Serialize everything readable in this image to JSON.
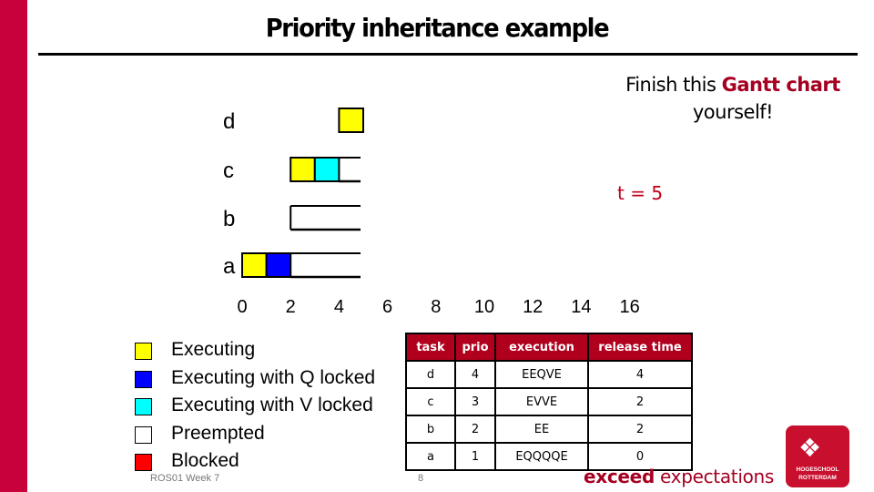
{
  "slide": {
    "title": "Priority inheritance example",
    "note_prefix": "Finish this ",
    "note_highlight": "Gantt chart",
    "note_suffix": "yourself!",
    "time_marker": "t = 5",
    "footer_left": "ROS01 Week 7",
    "page_number": "8",
    "brand_bold": "exceed",
    "brand_rest": " expectations",
    "logo_line1": "HOGESCHOOL",
    "logo_line2": "ROTTERDAM"
  },
  "colors": {
    "accent": "#c8003c",
    "executing": "#ffff00",
    "executing_q": "#0000ff",
    "executing_v": "#00ffff",
    "preempted": "#ffffff",
    "blocked": "#ff0000"
  },
  "legend": [
    {
      "state": "E",
      "label": "Executing",
      "color": "#ffff00"
    },
    {
      "state": "Q",
      "label": "Executing with Q locked",
      "color": "#0000ff"
    },
    {
      "state": "V",
      "label": "Executing with V locked",
      "color": "#00ffff"
    },
    {
      "state": "P",
      "label": "Preempted",
      "color": "#ffffff"
    },
    {
      "state": "B",
      "label": "Blocked",
      "color": "#ff0000"
    }
  ],
  "table": {
    "headers": [
      "task",
      "prio",
      "execution",
      "release time"
    ],
    "rows": [
      [
        "d",
        "4",
        "EEQVE",
        "4"
      ],
      [
        "c",
        "3",
        "EVVE",
        "2"
      ],
      [
        "b",
        "2",
        "EE",
        "2"
      ],
      [
        "a",
        "1",
        "EQQQQE",
        "0"
      ]
    ]
  },
  "chart_data": {
    "type": "gantt",
    "title": "",
    "xlabel": "",
    "ylabel": "",
    "x_ticks": [
      0,
      2,
      4,
      6,
      8,
      10,
      12,
      14,
      16
    ],
    "xlim": [
      0,
      16
    ],
    "tasks": [
      "d",
      "c",
      "b",
      "a"
    ],
    "current_time": 5,
    "segments": [
      {
        "task": "d",
        "start": 4,
        "end": 5,
        "state": "E"
      },
      {
        "task": "c",
        "start": 2,
        "end": 3,
        "state": "E"
      },
      {
        "task": "c",
        "start": 3,
        "end": 4,
        "state": "V"
      },
      {
        "task": "c",
        "start": 4,
        "end": 5,
        "state": "P"
      },
      {
        "task": "b",
        "start": 2,
        "end": 5,
        "state": "P"
      },
      {
        "task": "a",
        "start": 0,
        "end": 1,
        "state": "E"
      },
      {
        "task": "a",
        "start": 1,
        "end": 2,
        "state": "Q"
      },
      {
        "task": "a",
        "start": 2,
        "end": 5,
        "state": "P"
      }
    ]
  }
}
